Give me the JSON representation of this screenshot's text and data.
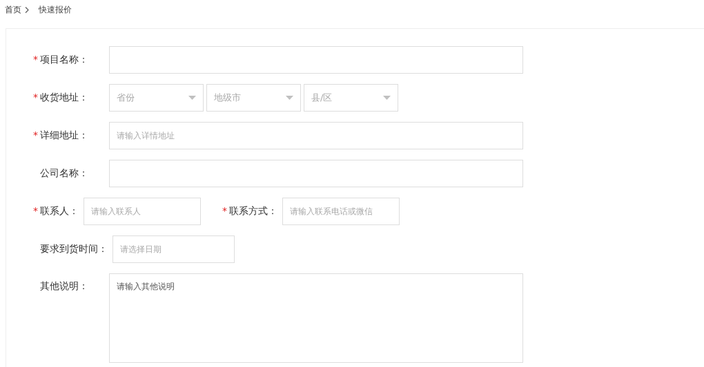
{
  "breadcrumb": [
    {
      "label": "首页",
      "selected": false
    },
    {
      "label": "快速报价",
      "selected": true
    }
  ],
  "rows": [
    {
      "fields": [
        {
          "kind": "wide",
          "required_mark": "*",
          "label": "项目名称："
        }
      ]
    },
    {
      "fields": [
        {
          "kind": "region",
          "required_mark": "*",
          "label": "收货地址：",
          "selects": [
            {
              "placeholder": "省份"
            },
            {
              "placeholder": "地级市"
            },
            {
              "placeholder": "县/区"
            }
          ]
        }
      ]
    },
    {
      "fields": [
        {
          "kind": "wide",
          "required_mark": "*",
          "label": "详细地址：",
          "placeholder": "请输入详情地址"
        }
      ]
    },
    {
      "fields": [
        {
          "kind": "wide",
          "label": "公司名称："
        }
      ]
    },
    {
      "fields": [
        {
          "kind": "short",
          "required_mark": "*",
          "label": "联系人：",
          "placeholder": "请输入联系人"
        },
        {
          "kind": "short",
          "required_mark": "*",
          "label": "联系方式：",
          "placeholder": "请输入联系电话或微信"
        }
      ]
    },
    {
      "fields": [
        {
          "kind": "date",
          "label": "要求到货时间：",
          "placeholder": "请选择日期"
        }
      ]
    },
    {
      "fields": [
        {
          "kind": "textarea",
          "label": "其他说明：",
          "placeholder": "请输入其他说明"
        }
      ]
    }
  ]
}
